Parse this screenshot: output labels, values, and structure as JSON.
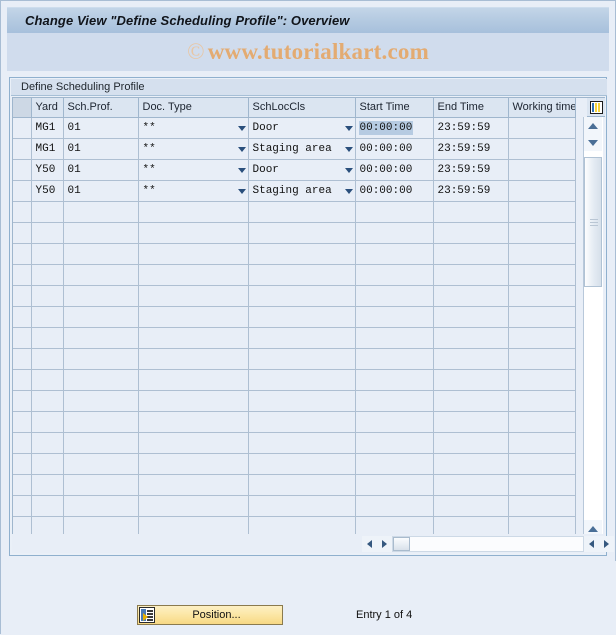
{
  "window": {
    "title": "Change View \"Define Scheduling Profile\": Overview",
    "watermark_mark": "©",
    "watermark_text": "www.tutorialkart.com"
  },
  "groupbox": {
    "title": "Define Scheduling Profile"
  },
  "table": {
    "columns": [
      {
        "key": "yard",
        "label": "Yard"
      },
      {
        "key": "schprof",
        "label": "Sch.Prof."
      },
      {
        "key": "doctype",
        "label": "Doc. Type"
      },
      {
        "key": "schloccls",
        "label": "SchLocCls"
      },
      {
        "key": "start",
        "label": "Start Time"
      },
      {
        "key": "end",
        "label": "End Time"
      },
      {
        "key": "working",
        "label": "Working time"
      }
    ],
    "config_icon": "table-settings-icon",
    "rows": [
      {
        "yard": "MG1",
        "schprof": "01",
        "doctype": "**",
        "schloccls": "Door",
        "start": "00:00:00",
        "end": "23:59:59",
        "working": ""
      },
      {
        "yard": "MG1",
        "schprof": "01",
        "doctype": "**",
        "schloccls": "Staging area",
        "start": "00:00:00",
        "end": "23:59:59",
        "working": ""
      },
      {
        "yard": "Y50",
        "schprof": "01",
        "doctype": "**",
        "schloccls": "Door",
        "start": "00:00:00",
        "end": "23:59:59",
        "working": ""
      },
      {
        "yard": "Y50",
        "schprof": "01",
        "doctype": "**",
        "schloccls": "Staging area",
        "start": "00:00:00",
        "end": "23:59:59",
        "working": ""
      }
    ],
    "empty_row_count": 16,
    "selected_cell": {
      "row": 0,
      "column": "start",
      "value": "00:00:00"
    }
  },
  "footer": {
    "position_button_label": "Position...",
    "entry_status": "Entry 1 of 4"
  },
  "colors": {
    "title_bar": "#b4cae1",
    "watermark": "#e3ab72",
    "group_bg": "#eaf0f8",
    "header_bg": "#dbe5f1",
    "key_cell_bg": "#dfe9f6",
    "selection_bg": "#b6cbe2",
    "button_yellow": "#fbe5a1",
    "grid_line": "#aebfd2"
  }
}
